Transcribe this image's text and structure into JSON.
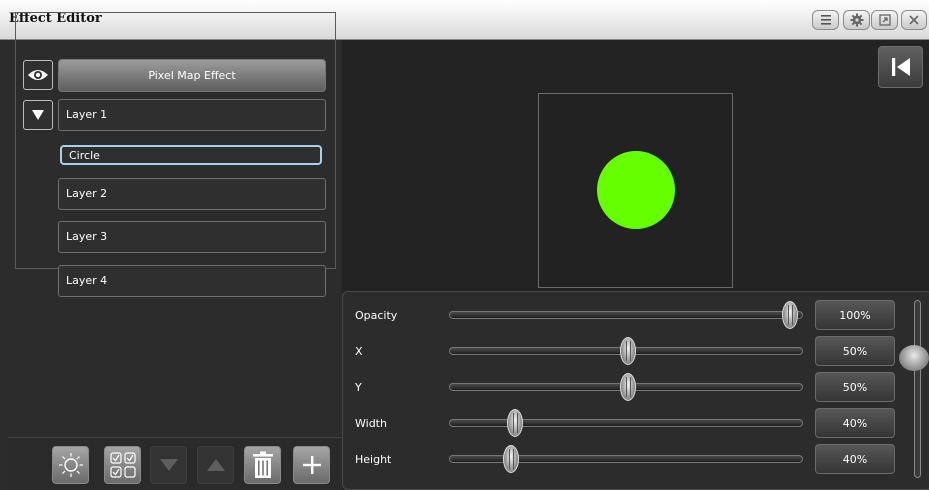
{
  "window": {
    "title": "Effect Editor"
  },
  "titlebar_buttons": [
    {
      "icon": "list-icon"
    },
    {
      "icon": "gear-icon"
    },
    {
      "icon": "expand-icon"
    },
    {
      "icon": "close-icon"
    }
  ],
  "tree": {
    "effect_label": "Pixel Map Effect",
    "layers": [
      {
        "label": "Layer 1"
      },
      {
        "label": "Circle"
      },
      {
        "label": "Layer 2"
      },
      {
        "label": "Layer 3"
      },
      {
        "label": "Layer 4"
      }
    ]
  },
  "preview": {
    "shape_color": "#66ff00"
  },
  "properties": [
    {
      "label": "Opacity",
      "value": "100%",
      "level": 1.0
    },
    {
      "label": "X",
      "value": "50%",
      "level": 0.5
    },
    {
      "label": "Y",
      "value": "50%",
      "level": 0.5
    },
    {
      "label": "Width",
      "value": "40%",
      "level": 0.15
    },
    {
      "label": "Height",
      "value": "40%",
      "level": 0.14
    }
  ],
  "toolbar": [
    {
      "icon": "brightness-icon"
    },
    {
      "icon": "select-multiple-icon"
    },
    {
      "icon": "move-down-icon"
    },
    {
      "icon": "move-up-icon"
    },
    {
      "icon": "trash-icon"
    },
    {
      "icon": "add-icon"
    }
  ]
}
